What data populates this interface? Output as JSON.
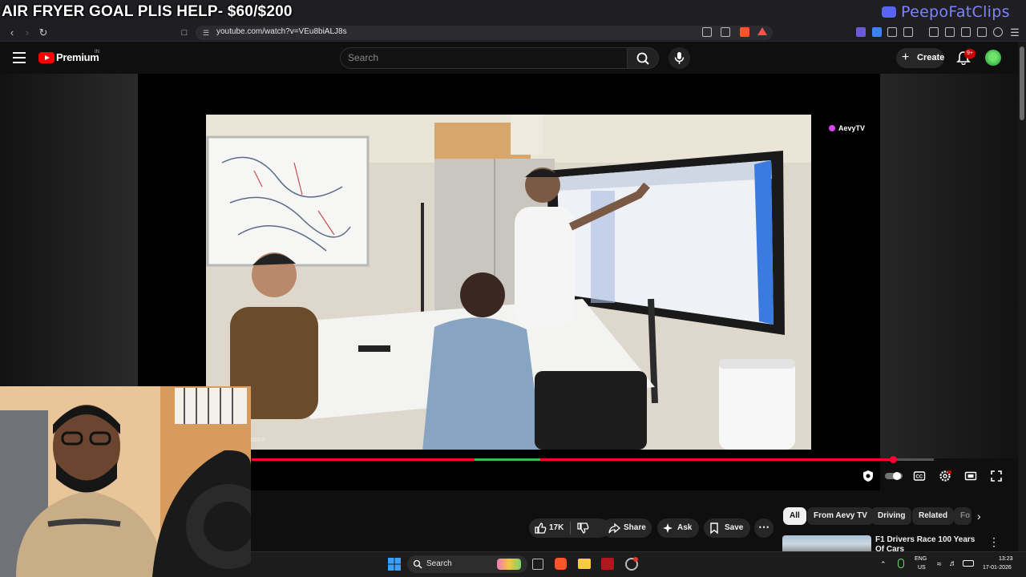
{
  "overlay": {
    "stream_title": "AIR FRYER GOAL PLIS HELP- $60/$200",
    "discord_name": "PeepoFatClips"
  },
  "browser": {
    "url": "youtube.com/watch?v=VEu8biALJ8s"
  },
  "youtube_header": {
    "brand": "Premium",
    "country_code": "IN",
    "search_placeholder": "Search",
    "create_label": "Create",
    "notifications_badge": "9+"
  },
  "player": {
    "channel_watermark": "AevyTV",
    "progress_fraction": 0.94
  },
  "actions": {
    "likes": "17K",
    "share_label": "Share",
    "ask_label": "Ask",
    "save_label": "Save"
  },
  "chips": [
    {
      "label": "All"
    },
    {
      "label": "From Aevy TV"
    },
    {
      "label": "Driving"
    },
    {
      "label": "Related"
    },
    {
      "label": "Fo"
    }
  ],
  "recommendation": {
    "title": "F1 Drivers Race 100 Years Of Cars"
  },
  "taskbar": {
    "search_label": "Search",
    "lang_top": "ENG",
    "lang_bottom": "US",
    "time": "13:23",
    "date": "17-01-2026"
  },
  "colors": {
    "youtube_red": "#ff0000",
    "progress_red": "#ff0033",
    "discord": "#5865f2"
  }
}
